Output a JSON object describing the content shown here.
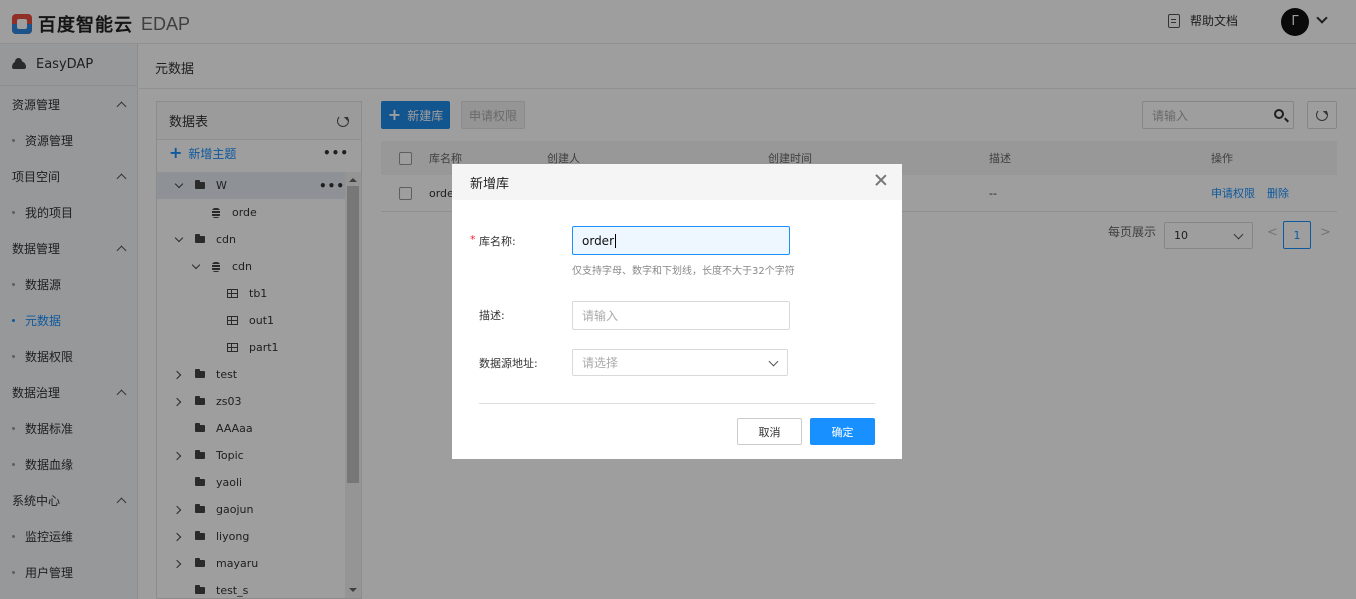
{
  "header": {
    "brand": "百度智能云",
    "product": "EDAP",
    "help_label": "帮助文档",
    "avatar_letter": "Γ"
  },
  "sidebar": {
    "brand": "EasyDAP",
    "groups": [
      {
        "label": "资源管理",
        "items": [
          {
            "label": "资源管理"
          }
        ]
      },
      {
        "label": "项目空间",
        "items": [
          {
            "label": "我的项目"
          }
        ]
      },
      {
        "label": "数据管理",
        "items": [
          {
            "label": "数据源"
          },
          {
            "label": "元数据",
            "active": true
          },
          {
            "label": "数据权限"
          }
        ]
      },
      {
        "label": "数据治理",
        "items": [
          {
            "label": "数据标准"
          },
          {
            "label": "数据血缘"
          }
        ]
      },
      {
        "label": "系统中心",
        "items": [
          {
            "label": "监控运维"
          },
          {
            "label": "用户管理"
          }
        ]
      }
    ]
  },
  "main": {
    "breadcrumb": "元数据"
  },
  "tree": {
    "title": "数据表",
    "add_topic": "新增主题",
    "more": "•••",
    "nodes": [
      {
        "label": "W",
        "selected": true
      },
      {
        "label": "orde"
      },
      {
        "label": "cdn"
      },
      {
        "label": "cdn"
      },
      {
        "label": "tb1"
      },
      {
        "label": "out1"
      },
      {
        "label": "part1"
      },
      {
        "label": "test"
      },
      {
        "label": "zs03"
      },
      {
        "label": "AAAaa"
      },
      {
        "label": "Topic"
      },
      {
        "label": "yaoli"
      },
      {
        "label": "gaojun"
      },
      {
        "label": "liyong"
      },
      {
        "label": "mayaru"
      },
      {
        "label": "test_s"
      }
    ]
  },
  "toolbar": {
    "new_db": "新建库",
    "apply": "申请权限",
    "search_placeholder": "请输入"
  },
  "table": {
    "columns": [
      "库名称",
      "创建人",
      "创建时间",
      "描述",
      "操作"
    ],
    "rows": [
      {
        "name": "orde",
        "creator": "",
        "time": "",
        "desc": "--",
        "ops": [
          "申请权限",
          "删除"
        ]
      }
    ]
  },
  "pagination": {
    "per_page_label": "每页展示",
    "page_size": "10",
    "prev": "<",
    "next": ">",
    "current": "1"
  },
  "modal": {
    "title": "新增库",
    "name_label": "库名称:",
    "name_value": "order",
    "name_hint": "仅支持字母、数字和下划线，长度不大于32个字符",
    "desc_label": "描述:",
    "desc_placeholder": "请输入",
    "source_label": "数据源地址:",
    "source_placeholder": "请选择",
    "cancel": "取消",
    "ok": "确定"
  },
  "colors": {
    "primary": "#1890ff",
    "selected_row": "#e6ebf2",
    "mask": "rgba(0,0,0,0.38)"
  }
}
